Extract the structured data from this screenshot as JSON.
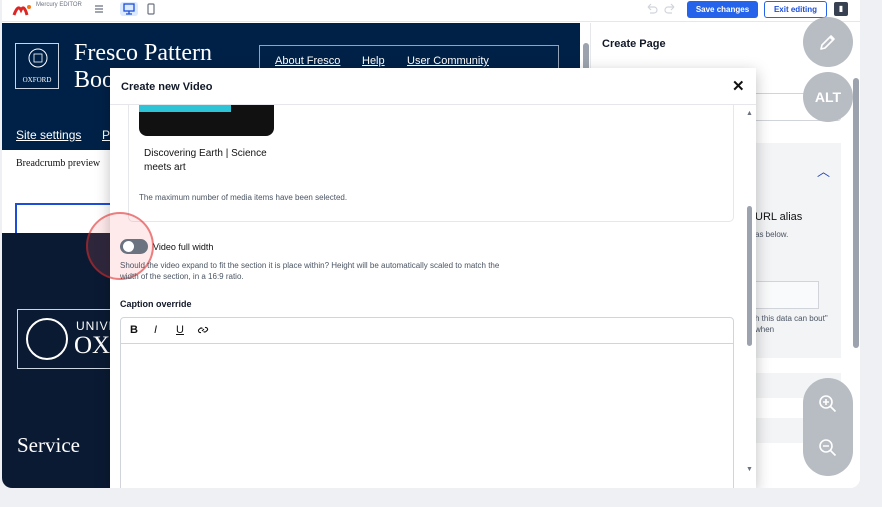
{
  "toolbar": {
    "brand_text": "Mercury EDITOR",
    "save_label": "Save changes",
    "exit_label": "Exit editing"
  },
  "site": {
    "logo_text": "OXFORD",
    "title": "Fresco Pattern Boo",
    "nav": [
      "About Fresco",
      "Help",
      "User Community"
    ],
    "links": [
      "Site settings",
      "P"
    ],
    "breadcrumb": "Breadcrumb preview",
    "footer_crest_small": "UNIVE",
    "footer_crest_big": "OX",
    "footer_heading": "Service"
  },
  "panel": {
    "title": "Create Page",
    "url_alias_label": "URL alias",
    "url_alias_help": "as below.",
    "url_alias_note": "h this data can bout\" when"
  },
  "modal": {
    "title": "Create new Video",
    "media_name": "Discovering Earth | Science meets art",
    "max_selected_text": "The maximum number of media items have been selected.",
    "toggle_label": "Video full width",
    "toggle_help": "Should the video expand to fit the section it is place within? Height will be automatically scaled to match the width of the section, in a 16:9 ratio.",
    "toggle_on": false,
    "caption_label": "Caption override",
    "editor_buttons": [
      "B",
      "I",
      "U",
      "🔗"
    ]
  },
  "floating": {
    "edit_icon": "pencil-icon",
    "alt_label": "ALT",
    "zoom_in_icon": "zoom-in-icon",
    "zoom_out_icon": "zoom-out-icon"
  },
  "colors": {
    "accent": "#2563eb",
    "oxford_blue": "#002147"
  }
}
